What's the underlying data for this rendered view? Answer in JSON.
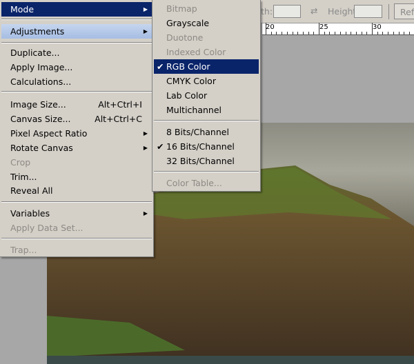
{
  "toolbar": {
    "width_label": "th:",
    "height_label": "Height:",
    "refine_button": "Ref",
    "swap_icon": "swap-arrows-icon"
  },
  "ruler": {
    "labels": [
      "20",
      "25",
      "30"
    ]
  },
  "image_menu": {
    "items": [
      {
        "label": "Mode",
        "submenu": true,
        "state": "selected"
      },
      {
        "label": "Adjustments",
        "submenu": true,
        "state": "hover"
      },
      {
        "label": "Duplicate..."
      },
      {
        "label": "Apply Image..."
      },
      {
        "label": "Calculations..."
      },
      {
        "label": "Image Size...",
        "shortcut": "Alt+Ctrl+I"
      },
      {
        "label": "Canvas Size...",
        "shortcut": "Alt+Ctrl+C"
      },
      {
        "label": "Pixel Aspect Ratio",
        "submenu": true
      },
      {
        "label": "Rotate Canvas",
        "submenu": true
      },
      {
        "label": "Crop",
        "disabled": true
      },
      {
        "label": "Trim..."
      },
      {
        "label": "Reveal All"
      },
      {
        "label": "Variables",
        "submenu": true
      },
      {
        "label": "Apply Data Set...",
        "disabled": true
      },
      {
        "label": "Trap...",
        "disabled": true
      }
    ]
  },
  "mode_submenu": {
    "items": [
      {
        "label": "Bitmap",
        "disabled": true
      },
      {
        "label": "Grayscale"
      },
      {
        "label": "Duotone",
        "disabled": true
      },
      {
        "label": "Indexed Color",
        "disabled": true
      },
      {
        "label": "RGB Color",
        "checked": true,
        "state": "selected"
      },
      {
        "label": "CMYK Color"
      },
      {
        "label": "Lab Color"
      },
      {
        "label": "Multichannel"
      },
      {
        "label": "8 Bits/Channel"
      },
      {
        "label": "16 Bits/Channel",
        "checked": true
      },
      {
        "label": "32 Bits/Channel"
      },
      {
        "label": "Color Table...",
        "disabled": true
      }
    ]
  },
  "glyphs": {
    "check": "✔",
    "arrow": "▶"
  },
  "colors": {
    "selection": "#0a246a",
    "hover": "#b6c9e9",
    "menu_bg": "#d4d0c8"
  }
}
